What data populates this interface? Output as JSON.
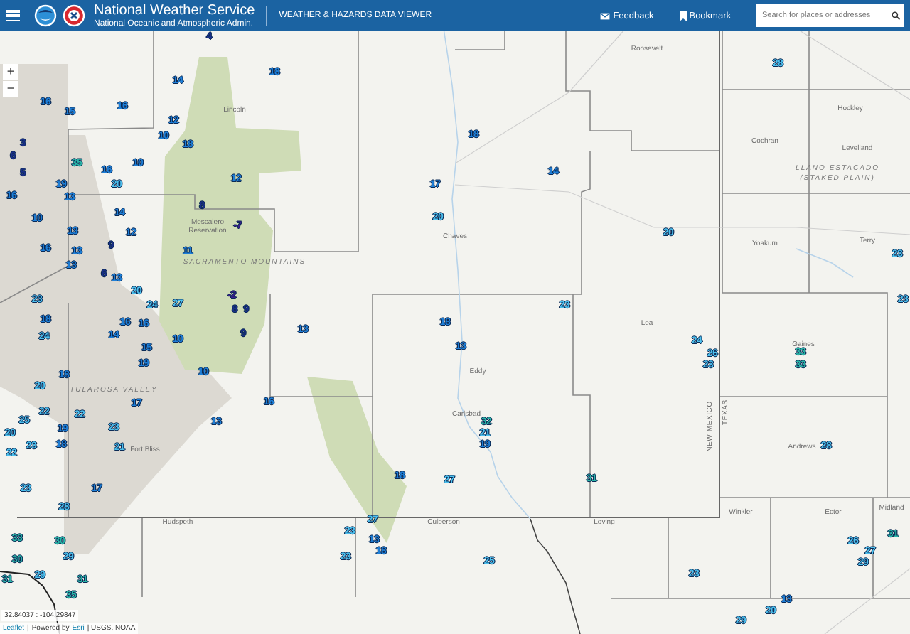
{
  "header": {
    "title": "National Weather Service",
    "subtitle": "National Oceanic and Atmospheric Admin.",
    "app_name": "WEATHER & HAZARDS DATA VIEWER",
    "links": [
      "Feedback",
      "Bookmark"
    ],
    "search": {
      "placeholder": "Search for places or addresses"
    }
  },
  "map": {
    "zoom_controls": [
      "+",
      "−"
    ],
    "place_labels": [
      {
        "text": "Lincoln",
        "kind": "place"
      },
      {
        "text": "Roosevelt",
        "kind": "place"
      },
      {
        "text": "Chaves",
        "kind": "place"
      },
      {
        "text": "Cochran",
        "kind": "place"
      },
      {
        "text": "Hockley",
        "kind": "place"
      },
      {
        "text": "Levelland",
        "kind": "place"
      },
      {
        "text": "LLANO ESTACADO",
        "kind": "region"
      },
      {
        "text": "(STAKED PLAIN)",
        "kind": "region"
      },
      {
        "text": "Yoakum",
        "kind": "place"
      },
      {
        "text": "Terry",
        "kind": "place"
      },
      {
        "text": "Lea",
        "kind": "place"
      },
      {
        "text": "Gaines",
        "kind": "place"
      },
      {
        "text": "Eddy",
        "kind": "place"
      },
      {
        "text": "Carlsbad",
        "kind": "place"
      },
      {
        "text": "Andrews",
        "kind": "place"
      },
      {
        "text": "Loving",
        "kind": "place"
      },
      {
        "text": "Winkler",
        "kind": "place"
      },
      {
        "text": "Ector",
        "kind": "place"
      },
      {
        "text": "Midland",
        "kind": "place"
      },
      {
        "text": "Mescalero Reservation",
        "kind": "area"
      },
      {
        "text": "SACRAMENTO MOUNTAINS",
        "kind": "region"
      },
      {
        "text": "TULAROSA VALLEY",
        "kind": "region"
      },
      {
        "text": "Fort Bliss",
        "kind": "place"
      },
      {
        "text": "Hudspeth",
        "kind": "place"
      },
      {
        "text": "Culberson",
        "kind": "place"
      },
      {
        "text": "NEW MEXICO",
        "kind": "vertical"
      },
      {
        "text": "TEXAS",
        "kind": "vertical"
      }
    ],
    "markers": [
      {
        "value": "4",
        "color": "#1a2f8a"
      },
      {
        "value": "14",
        "color": "#1e7fd8"
      },
      {
        "value": "18",
        "color": "#1e7fd8"
      },
      {
        "value": "16",
        "color": "#1e7fd8"
      },
      {
        "value": "15",
        "color": "#1e7fd8"
      },
      {
        "value": "16",
        "color": "#1e7fd8"
      },
      {
        "value": "12",
        "color": "#1e7fd8"
      },
      {
        "value": "10",
        "color": "#1e7fd8"
      },
      {
        "value": "18",
        "color": "#1e7fd8"
      },
      {
        "value": "3",
        "color": "#1a2f8a"
      },
      {
        "value": "6",
        "color": "#1a2f8a"
      },
      {
        "value": "5",
        "color": "#1a2f8a"
      },
      {
        "value": "35",
        "color": "#2ab7a9"
      },
      {
        "value": "16",
        "color": "#1e7fd8"
      },
      {
        "value": "10",
        "color": "#1e7fd8"
      },
      {
        "value": "19",
        "color": "#1e7fd8"
      },
      {
        "value": "20",
        "color": "#4cc0ee"
      },
      {
        "value": "13",
        "color": "#1e7fd8"
      },
      {
        "value": "16",
        "color": "#1e7fd8"
      },
      {
        "value": "12",
        "color": "#1e7fd8"
      },
      {
        "value": "8",
        "color": "#1a2f8a"
      },
      {
        "value": "-7",
        "color": "#3b1f8f"
      },
      {
        "value": "14",
        "color": "#1e7fd8"
      },
      {
        "value": "12",
        "color": "#1e7fd8"
      },
      {
        "value": "10",
        "color": "#1e7fd8"
      },
      {
        "value": "13",
        "color": "#1e7fd8"
      },
      {
        "value": "9",
        "color": "#1a2f8a"
      },
      {
        "value": "16",
        "color": "#1e7fd8"
      },
      {
        "value": "13",
        "color": "#1e7fd8"
      },
      {
        "value": "13",
        "color": "#1e7fd8"
      },
      {
        "value": "11",
        "color": "#1e7fd8"
      },
      {
        "value": "6",
        "color": "#1a2f8a"
      },
      {
        "value": "13",
        "color": "#1e7fd8"
      },
      {
        "value": "20",
        "color": "#4cc0ee"
      },
      {
        "value": "-2",
        "color": "#3b1f8f"
      },
      {
        "value": "23",
        "color": "#4cc0ee"
      },
      {
        "value": "24",
        "color": "#4cc0ee"
      },
      {
        "value": "27",
        "color": "#4cc0ee"
      },
      {
        "value": "8",
        "color": "#1a2f8a"
      },
      {
        "value": "9",
        "color": "#1a2f8a"
      },
      {
        "value": "18",
        "color": "#1e7fd8"
      },
      {
        "value": "24",
        "color": "#4cc0ee"
      },
      {
        "value": "14",
        "color": "#1e7fd8"
      },
      {
        "value": "16",
        "color": "#1e7fd8"
      },
      {
        "value": "16",
        "color": "#1e7fd8"
      },
      {
        "value": "10",
        "color": "#1e7fd8"
      },
      {
        "value": "15",
        "color": "#1e7fd8"
      },
      {
        "value": "19",
        "color": "#1e7fd8"
      },
      {
        "value": "9",
        "color": "#1a2f8a"
      },
      {
        "value": "13",
        "color": "#1e7fd8"
      },
      {
        "value": "18",
        "color": "#1e7fd8"
      },
      {
        "value": "18",
        "color": "#1e7fd8"
      },
      {
        "value": "10",
        "color": "#1e7fd8"
      },
      {
        "value": "20",
        "color": "#4cc0ee"
      },
      {
        "value": "17",
        "color": "#1e7fd8"
      },
      {
        "value": "16",
        "color": "#1e7fd8"
      },
      {
        "value": "22",
        "color": "#4cc0ee"
      },
      {
        "value": "25",
        "color": "#4cc0ee"
      },
      {
        "value": "13",
        "color": "#1e7fd8"
      },
      {
        "value": "23",
        "color": "#4cc0ee"
      },
      {
        "value": "19",
        "color": "#1e7fd8"
      },
      {
        "value": "22",
        "color": "#4cc0ee"
      },
      {
        "value": "20",
        "color": "#4cc0ee"
      },
      {
        "value": "18",
        "color": "#1e7fd8"
      },
      {
        "value": "22",
        "color": "#4cc0ee"
      },
      {
        "value": "23",
        "color": "#4cc0ee"
      },
      {
        "value": "21",
        "color": "#4cc0ee"
      },
      {
        "value": "17",
        "color": "#1e7fd8"
      },
      {
        "value": "23",
        "color": "#4cc0ee"
      },
      {
        "value": "18",
        "color": "#1e7fd8"
      },
      {
        "value": "27",
        "color": "#4cc0ee"
      },
      {
        "value": "28",
        "color": "#4cc0ee"
      },
      {
        "value": "27",
        "color": "#4cc0ee"
      },
      {
        "value": "23",
        "color": "#4cc0ee"
      },
      {
        "value": "13",
        "color": "#1e7fd8"
      },
      {
        "value": "18",
        "color": "#1e7fd8"
      },
      {
        "value": "23",
        "color": "#4cc0ee"
      },
      {
        "value": "33",
        "color": "#2ab7a9"
      },
      {
        "value": "30",
        "color": "#2ab7a9"
      },
      {
        "value": "30",
        "color": "#2ab7a9"
      },
      {
        "value": "29",
        "color": "#4cc0ee"
      },
      {
        "value": "31",
        "color": "#2ab7a9"
      },
      {
        "value": "29",
        "color": "#4cc0ee"
      },
      {
        "value": "31",
        "color": "#2ab7a9"
      },
      {
        "value": "35",
        "color": "#2ab7a9"
      },
      {
        "value": "13",
        "color": "#1e7fd8"
      },
      {
        "value": "24",
        "color": "#4cc0ee"
      },
      {
        "value": "26",
        "color": "#4cc0ee"
      },
      {
        "value": "23",
        "color": "#4cc0ee"
      },
      {
        "value": "33",
        "color": "#2ab7a9"
      },
      {
        "value": "33",
        "color": "#2ab7a9"
      },
      {
        "value": "32",
        "color": "#2ab7a9"
      },
      {
        "value": "21",
        "color": "#4cc0ee"
      },
      {
        "value": "19",
        "color": "#1e7fd8"
      },
      {
        "value": "31",
        "color": "#2ab7a9"
      },
      {
        "value": "28",
        "color": "#4cc0ee"
      },
      {
        "value": "25",
        "color": "#4cc0ee"
      },
      {
        "value": "23",
        "color": "#4cc0ee"
      },
      {
        "value": "31",
        "color": "#2ab7a9"
      },
      {
        "value": "26",
        "color": "#4cc0ee"
      },
      {
        "value": "27",
        "color": "#4cc0ee"
      },
      {
        "value": "29",
        "color": "#4cc0ee"
      },
      {
        "value": "13",
        "color": "#1e7fd8"
      },
      {
        "value": "20",
        "color": "#4cc0ee"
      },
      {
        "value": "29",
        "color": "#4cc0ee"
      },
      {
        "value": "18",
        "color": "#1e7fd8"
      },
      {
        "value": "14",
        "color": "#1e7fd8"
      },
      {
        "value": "17",
        "color": "#1e7fd8"
      },
      {
        "value": "20",
        "color": "#4cc0ee"
      },
      {
        "value": "20",
        "color": "#4cc0ee"
      },
      {
        "value": "23",
        "color": "#4cc0ee"
      },
      {
        "value": "28",
        "color": "#4cc0ee"
      },
      {
        "value": "23",
        "color": "#4cc0ee"
      },
      {
        "value": "23",
        "color": "#4cc0ee"
      }
    ],
    "coordinates": "32.84037 : -104.29847",
    "attribution": {
      "links": [
        "Leaflet",
        "Esri"
      ],
      "separator": "|",
      "powered_by": "Powered by",
      "sources": "| USGS, NOAA"
    }
  }
}
